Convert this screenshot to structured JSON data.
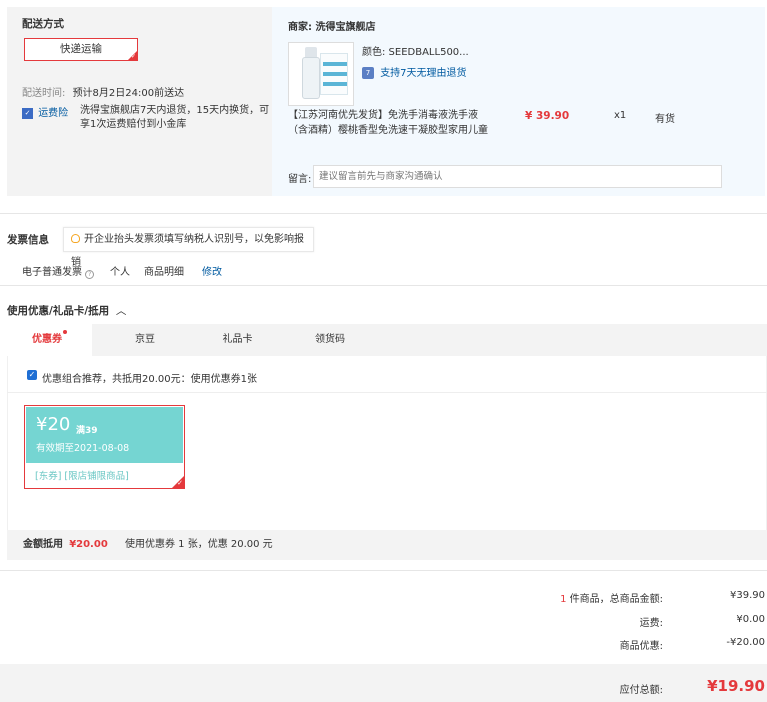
{
  "delivery": {
    "title": "配送方式",
    "method_button": "快递运输",
    "time_label": "配送时间:",
    "time_value": "预计8月2日24:00前送达",
    "insurance_tag": "运费险",
    "insurance_text_line1": "洗得宝旗舰店7天内退货，15天内换货，可",
    "insurance_text_line2": "享1次运费赔付到小金库"
  },
  "merchant": {
    "label": "商家: 洗得宝旗舰店",
    "color_label": "颜色: SEEDBALL500...",
    "return_policy": "支持7天无理由退货",
    "product_title_line1": "【江苏河南优先发货】免洗手消毒液洗手液",
    "product_title_line2": "（含酒精）樱桃香型免洗速干凝胶型家用儿童",
    "price": "¥ 39.90",
    "quantity": "x1",
    "stock": "有货",
    "note_label": "留言:",
    "note_placeholder": "建议留言前先与商家沟通确认"
  },
  "invoice": {
    "title": "发票信息",
    "tip": "开企业抬头发票须填写纳税人识别号，以免影响报销",
    "type": "电子普通发票",
    "holder": "个人",
    "content": "商品明细",
    "edit_link": "修改"
  },
  "discount": {
    "title": "使用优惠/礼品卡/抵用",
    "tabs": [
      "优惠券",
      "京豆",
      "礼品卡",
      "领货码"
    ],
    "recommend_text": "优惠组合推荐，共抵用20.00元：使用优惠券1张",
    "coupon": {
      "amount": "¥20",
      "condition": "满39",
      "validity": "有效期至2021-08-08",
      "tags": "[东券] [限店铺限商品]"
    },
    "summary_label": "金额抵用",
    "summary_amount": "¥20.00",
    "summary_detail": "使用优惠券 1 张，优惠 20.00 元"
  },
  "totals": {
    "count": "1",
    "items_label": " 件商品，总商品金额:",
    "items_value": "¥39.90",
    "shipping_label": "运费:",
    "shipping_value": "¥0.00",
    "discount_label": "商品优惠:",
    "discount_value": "-¥20.00",
    "payable_label": "应付总额:",
    "payable_value": "¥19.90"
  },
  "colors": {
    "accent": "#e4393c",
    "link": "#005aa0",
    "coupon_bg": "#75d5d2"
  }
}
